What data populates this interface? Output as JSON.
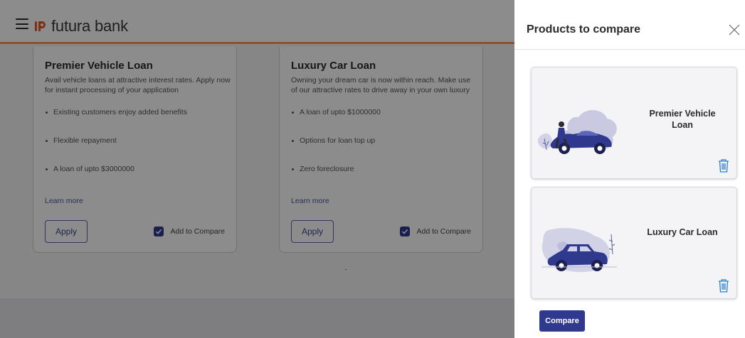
{
  "header": {
    "brand": "futura bank"
  },
  "cards": [
    {
      "title": "Premier Vehicle Loan",
      "description": "Avail vehicle loans at attractive interest rates. Apply now for instant processing of your application",
      "features": [
        "Existing customers enjoy added benefits",
        "Flexible repayment",
        "A loan of upto $3000000"
      ],
      "learn_more": "Learn more",
      "apply": "Apply",
      "compare_label": "Add to Compare"
    },
    {
      "title": "Luxury Car Loan",
      "description": "Owning your dream car is now within reach. Make use of our attractive rates to drive away in your own luxury",
      "features": [
        "A loan of upto $1000000",
        "Options for loan top up",
        "Zero foreclosure"
      ],
      "learn_more": "Learn more",
      "apply": "Apply",
      "compare_label": "Add to Compare"
    }
  ],
  "panel": {
    "title": "Products to compare",
    "products": [
      {
        "name": "Premier Vehicle Loan",
        "icon": "delete-icon"
      },
      {
        "name": "Luxury Car Loan",
        "icon": "delete-icon"
      }
    ],
    "compare_button": "Compare"
  },
  "colors": {
    "brand_primary": "#2f3a8f",
    "accent_orange": "#f39a5e",
    "link": "#4a56a6",
    "trash_icon": "#2a7fd1"
  }
}
